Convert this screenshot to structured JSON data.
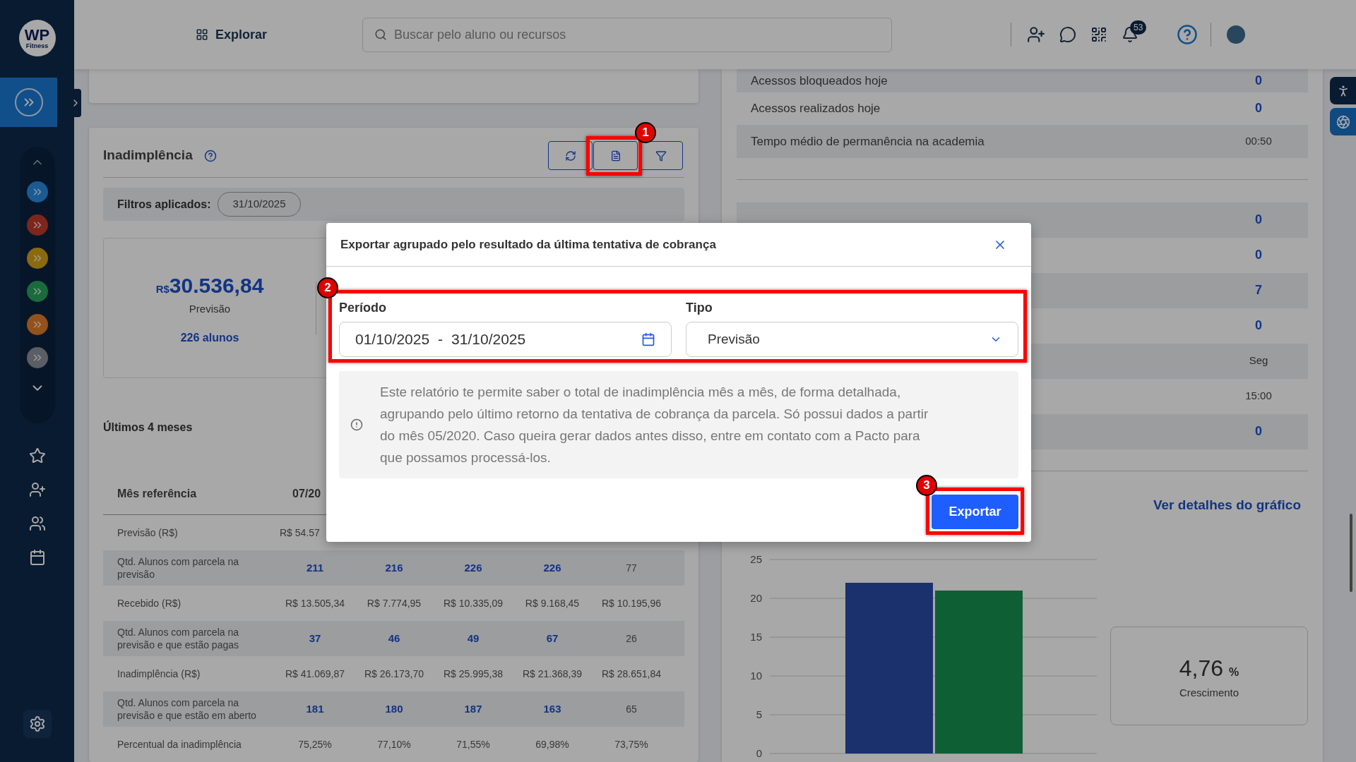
{
  "sidebar": {
    "logo_text": "WP",
    "logo_subtext": "Fitness"
  },
  "header": {
    "explore": "Explorar",
    "search": {
      "placeholder": "Buscar pelo aluno ou recursos"
    },
    "notification_count": "53"
  },
  "delinquency_card": {
    "title": "Inadimplência",
    "filters_label": "Filtros aplicados:",
    "filters": [
      "31/10/2025"
    ],
    "kpi": {
      "currency": "R$",
      "value": "30.536,84",
      "label": "Previsão",
      "link": "226 alunos"
    },
    "section_title": "Últimos 4 meses",
    "table": {
      "columns": [
        "Mês referência",
        "07/20"
      ],
      "rows": [
        {
          "cells": [
            {
              "text": "Previsão (R$)",
              "kind": "label"
            },
            {
              "text": "R$ 54.57",
              "kind": "plain"
            }
          ]
        },
        {
          "cells": [
            {
              "text": "Qtd. Alunos com parcela na previsão",
              "kind": "label"
            },
            {
              "text": "211",
              "kind": "link"
            },
            {
              "text": "216",
              "kind": "link"
            },
            {
              "text": "226",
              "kind": "link"
            },
            {
              "text": "226",
              "kind": "link"
            },
            {
              "text": "77",
              "kind": "plain"
            }
          ]
        },
        {
          "cells": [
            {
              "text": "Recebido (R$)",
              "kind": "label"
            },
            {
              "text": "R$ 13.505,34",
              "kind": "plain"
            },
            {
              "text": "R$ 7.774,95",
              "kind": "plain"
            },
            {
              "text": "R$ 10.335,09",
              "kind": "plain"
            },
            {
              "text": "R$ 9.168,45",
              "kind": "plain"
            },
            {
              "text": "R$ 10.195,96",
              "kind": "plain"
            }
          ]
        },
        {
          "cells": [
            {
              "text": "Qtd. Alunos com parcela na previsão e que estão pagas",
              "kind": "label"
            },
            {
              "text": "37",
              "kind": "link"
            },
            {
              "text": "46",
              "kind": "link"
            },
            {
              "text": "49",
              "kind": "link"
            },
            {
              "text": "67",
              "kind": "link"
            },
            {
              "text": "26",
              "kind": "plain"
            }
          ]
        },
        {
          "cells": [
            {
              "text": "Inadimplência (R$)",
              "kind": "label"
            },
            {
              "text": "R$ 41.069,87",
              "kind": "plain"
            },
            {
              "text": "R$ 26.173,70",
              "kind": "plain"
            },
            {
              "text": "R$ 25.995,38",
              "kind": "plain"
            },
            {
              "text": "R$ 21.368,39",
              "kind": "plain"
            },
            {
              "text": "R$ 28.651,84",
              "kind": "plain"
            }
          ]
        },
        {
          "cells": [
            {
              "text": "Qtd. Alunos com parcela na previsão e que estão em aberto",
              "kind": "label"
            },
            {
              "text": "181",
              "kind": "link"
            },
            {
              "text": "180",
              "kind": "link"
            },
            {
              "text": "187",
              "kind": "link"
            },
            {
              "text": "163",
              "kind": "link"
            },
            {
              "text": "65",
              "kind": "plain"
            }
          ]
        },
        {
          "cells": [
            {
              "text": "Percentual da inadimplência",
              "kind": "label"
            },
            {
              "text": "75,25%",
              "kind": "plain"
            },
            {
              "text": "77,10%",
              "kind": "plain"
            },
            {
              "text": "71,55%",
              "kind": "plain"
            },
            {
              "text": "69,98%",
              "kind": "plain"
            },
            {
              "text": "73,75%",
              "kind": "plain"
            }
          ]
        }
      ]
    }
  },
  "access_panel": {
    "rows": [
      {
        "label": "Acessos bloqueados hoje",
        "value": "0",
        "kind": "count"
      },
      {
        "label": "Acessos realizados hoje",
        "value": "0",
        "kind": "count"
      },
      {
        "label": "Tempo médio de permanência na academia",
        "value": "00:50",
        "kind": "text"
      }
    ],
    "value_rows": [
      {
        "value": "0",
        "kind": "count"
      },
      {
        "value": "0",
        "kind": "count"
      },
      {
        "value": "7",
        "kind": "count"
      },
      {
        "value": "0",
        "kind": "count"
      },
      {
        "value": "Seg",
        "kind": "text"
      },
      {
        "value": "15:00",
        "kind": "text"
      },
      {
        "value": "0",
        "kind": "count"
      }
    ],
    "chart_link": "Ver detalhes do gráfico",
    "chart_data": {
      "type": "bar",
      "series": [
        {
          "color": "#2a4ba8",
          "values": [
            22
          ]
        },
        {
          "color": "#17914f",
          "values": [
            21
          ]
        }
      ],
      "ylim": [
        0,
        25
      ],
      "yticks": [
        0,
        5,
        10,
        15,
        20,
        25
      ],
      "grid": true
    },
    "growth": {
      "value": "4,76",
      "unit": "%",
      "label": "Crescimento"
    }
  },
  "dialog": {
    "title": "Exportar agrupado pelo resultado da última tentativa de cobrança",
    "period": {
      "label": "Período",
      "start": "01/10/2025",
      "separator": "-",
      "end": "31/10/2025"
    },
    "type": {
      "label": "Tipo",
      "value": "Previsão"
    },
    "info": "Este relatório te permite saber o total de inadimplência mês a mês, de forma detalhada, agrupando pelo último retorno da tentativa de cobrança da parcela. Só possui dados a partir do mês 05/2020. Caso queira gerar dados antes disso, entre em contato com a Pacto para que possamos processá-los.",
    "button": "Exportar"
  },
  "annotations": [
    {
      "number": "1"
    },
    {
      "number": "2"
    },
    {
      "number": "3"
    }
  ]
}
